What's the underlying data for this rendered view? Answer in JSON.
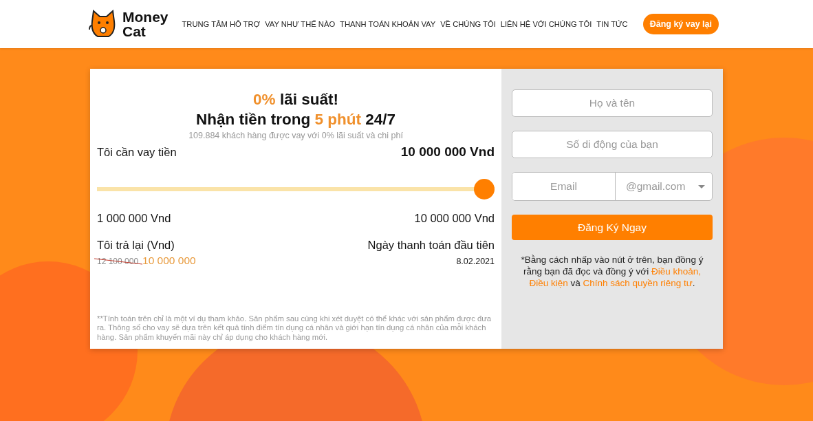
{
  "header": {
    "logo": [
      "Money",
      "Cat"
    ],
    "nav": [
      "TRUNG TÂM HỖ TRỢ",
      "VAY NHƯ THẾ NÀO",
      "THANH TOÁN KHOẢN VAY",
      "VỀ CHÚNG TÔI",
      "LIÊN HỆ VỚI CHÚNG TÔI",
      "TIN TỨC"
    ],
    "cta": "Đăng ký vay lại"
  },
  "calculator": {
    "headline": [
      [
        {
          "text": "0%",
          "accent": true
        },
        {
          "text": " lãi suất!",
          "accent": false
        }
      ],
      [
        {
          "text": "Nhận tiền trong ",
          "accent": false
        },
        {
          "text": "5 phút",
          "accent": true
        },
        {
          "text": " 24/7",
          "accent": false
        }
      ]
    ],
    "subtitle": "109.884 khách hàng được vay với 0% lãi suất và chi phí",
    "amount_label": "Tôi cần vay tiền",
    "amount_value": "10 000 000 Vnd",
    "slider": {
      "level": 1.0
    },
    "min": "1 000 000 Vnd",
    "max": "10 000 000 Vnd",
    "repay_label": "Tôi trả lại (Vnd)",
    "old_price": "12 100 000",
    "new_price": "10 000 000",
    "date_label": "Ngày thanh toán đầu tiên",
    "date_value": "8.02.2021",
    "disclaimer": "**Tính toán trên chỉ là một ví dụ tham khảo. Sản phẩm sau cùng khi xét duyệt có thể khác với sản phẩm được đưa ra. Thông số cho vay sẽ dựa trên kết quả tính điểm tín dụng cá nhân và giới hạn tín dụng cá nhân của mỗi khách hàng. Sản phẩm khuyến mãi này chỉ áp dụng cho khách hàng mới."
  },
  "form": {
    "name": {
      "placeholder": "Họ và tên"
    },
    "phone": {
      "placeholder": "Số di động của bạn"
    },
    "email": {
      "placeholder": "Email"
    },
    "domain": "@gmail.com",
    "submit": "Đăng Ký Ngay",
    "terms": [
      {
        "kind": "text",
        "text": "*Bằng cách nhấp vào nút ở trên, bạn đồng ý rằng bạn đã đọc và đồng ý với "
      },
      {
        "kind": "link",
        "text": "Điều khoản,"
      },
      {
        "kind": "link",
        "text": "Điều kiện"
      },
      {
        "kind": "text",
        "text": " và "
      },
      {
        "kind": "link",
        "text": "Chính sách quyền riêng tư"
      },
      {
        "kind": "text",
        "text": "."
      }
    ]
  }
}
